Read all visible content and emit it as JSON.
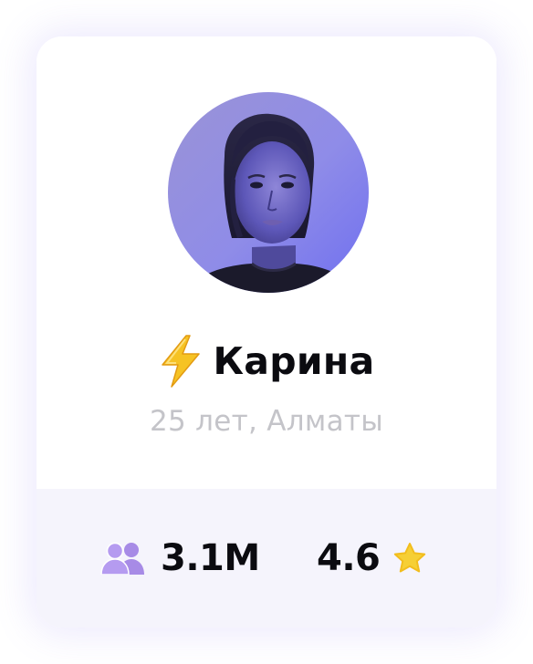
{
  "profile": {
    "name_emoji": "⚡",
    "name": "Карина",
    "details": "25 лет, Алматы",
    "avatar": "woman-portrait-photo"
  },
  "stats": {
    "followers": {
      "icon": "users-icon",
      "value": "3.1M"
    },
    "rating": {
      "icon": "star-icon",
      "value": "4.6"
    }
  },
  "colors": {
    "accent_purple": "#a78be6",
    "star_yellow": "#f6cf35",
    "bolt_yellow": "#f6c324",
    "stats_bg": "#f5f4fc",
    "secondary_text": "#c4c4c9"
  }
}
